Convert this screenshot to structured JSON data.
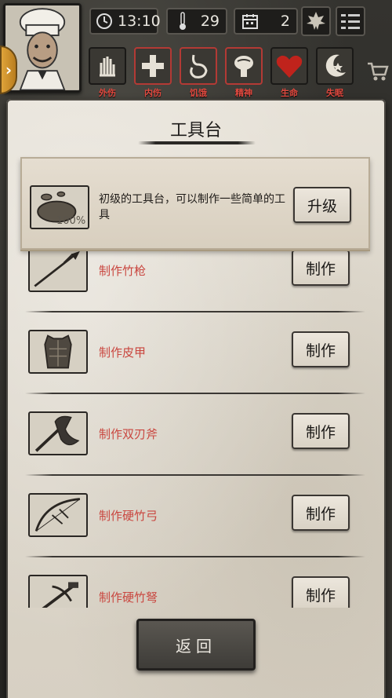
{
  "hud": {
    "time": "13:10",
    "temperature": "29",
    "day": "2",
    "side_tab_glyph": "›"
  },
  "conditions": [
    {
      "label": "外伤",
      "icon": "hand-icon",
      "alert": false
    },
    {
      "label": "内伤",
      "icon": "cross-icon",
      "alert": true
    },
    {
      "label": "饥饿",
      "icon": "stomach-icon",
      "alert": true
    },
    {
      "label": "精神",
      "icon": "brain-icon",
      "alert": true
    },
    {
      "label": "生命",
      "icon": "heart-icon",
      "alert": false
    },
    {
      "label": "失眠",
      "icon": "moon-icon",
      "alert": false
    }
  ],
  "panel": {
    "title": "工具台",
    "bench": {
      "progress_percent": "100%",
      "description": "初级的工具台，可以制作一些简单的工具",
      "upgrade_label": "升级"
    },
    "recipes": [
      {
        "label": "制作竹枪",
        "icon": "spear-icon",
        "button": "制作"
      },
      {
        "label": "制作皮甲",
        "icon": "leather-armor-icon",
        "button": "制作"
      },
      {
        "label": "制作双刃斧",
        "icon": "double-axe-icon",
        "button": "制作"
      },
      {
        "label": "制作硬竹弓",
        "icon": "bow-icon",
        "button": "制作"
      },
      {
        "label": "制作硬竹弩",
        "icon": "crossbow-icon",
        "button": "制作"
      }
    ],
    "back_label": "返回"
  },
  "colors": {
    "alert_border": "#b33a35",
    "recipe_text": "#c9463f",
    "condition_label": "#e14a40",
    "side_tab": "#e0a43a"
  }
}
